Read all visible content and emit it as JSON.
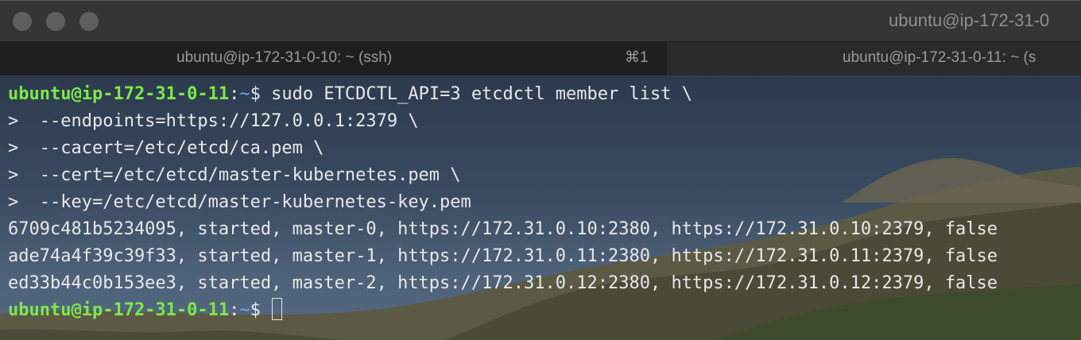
{
  "window": {
    "title": "ubuntu@ip-172-31-0"
  },
  "tabs": [
    {
      "label": "ubuntu@ip-172-31-0-10: ~ (ssh)",
      "shortcut": "⌘1"
    },
    {
      "label": "ubuntu@ip-172-31-0-11: ~ (s"
    }
  ],
  "prompt": {
    "user_host": "ubuntu@ip-172-31-0-11",
    "colon": ":",
    "path": "~",
    "symbol": "$ "
  },
  "terminal": {
    "command": "sudo ETCDCTL_API=3 etcdctl member list \\",
    "continuations": [
      ">  --endpoints=https://127.0.0.1:2379 \\",
      ">  --cacert=/etc/etcd/ca.pem \\",
      ">  --cert=/etc/etcd/master-kubernetes.pem \\",
      ">  --key=/etc/etcd/master-kubernetes-key.pem"
    ],
    "output": [
      "6709c481b5234095, started, master-0, https://172.31.0.10:2380, https://172.31.0.10:2379, false",
      "ade74a4f39c39f33, started, master-1, https://172.31.0.11:2380, https://172.31.0.11:2379, false",
      "ed33b44c0b153ee3, started, master-2, https://172.31.0.12:2380, https://172.31.0.12:2379, false"
    ]
  },
  "colors": {
    "user": "#7ee84a",
    "path": "#6fa7e6",
    "text": "#e8e8e8"
  }
}
